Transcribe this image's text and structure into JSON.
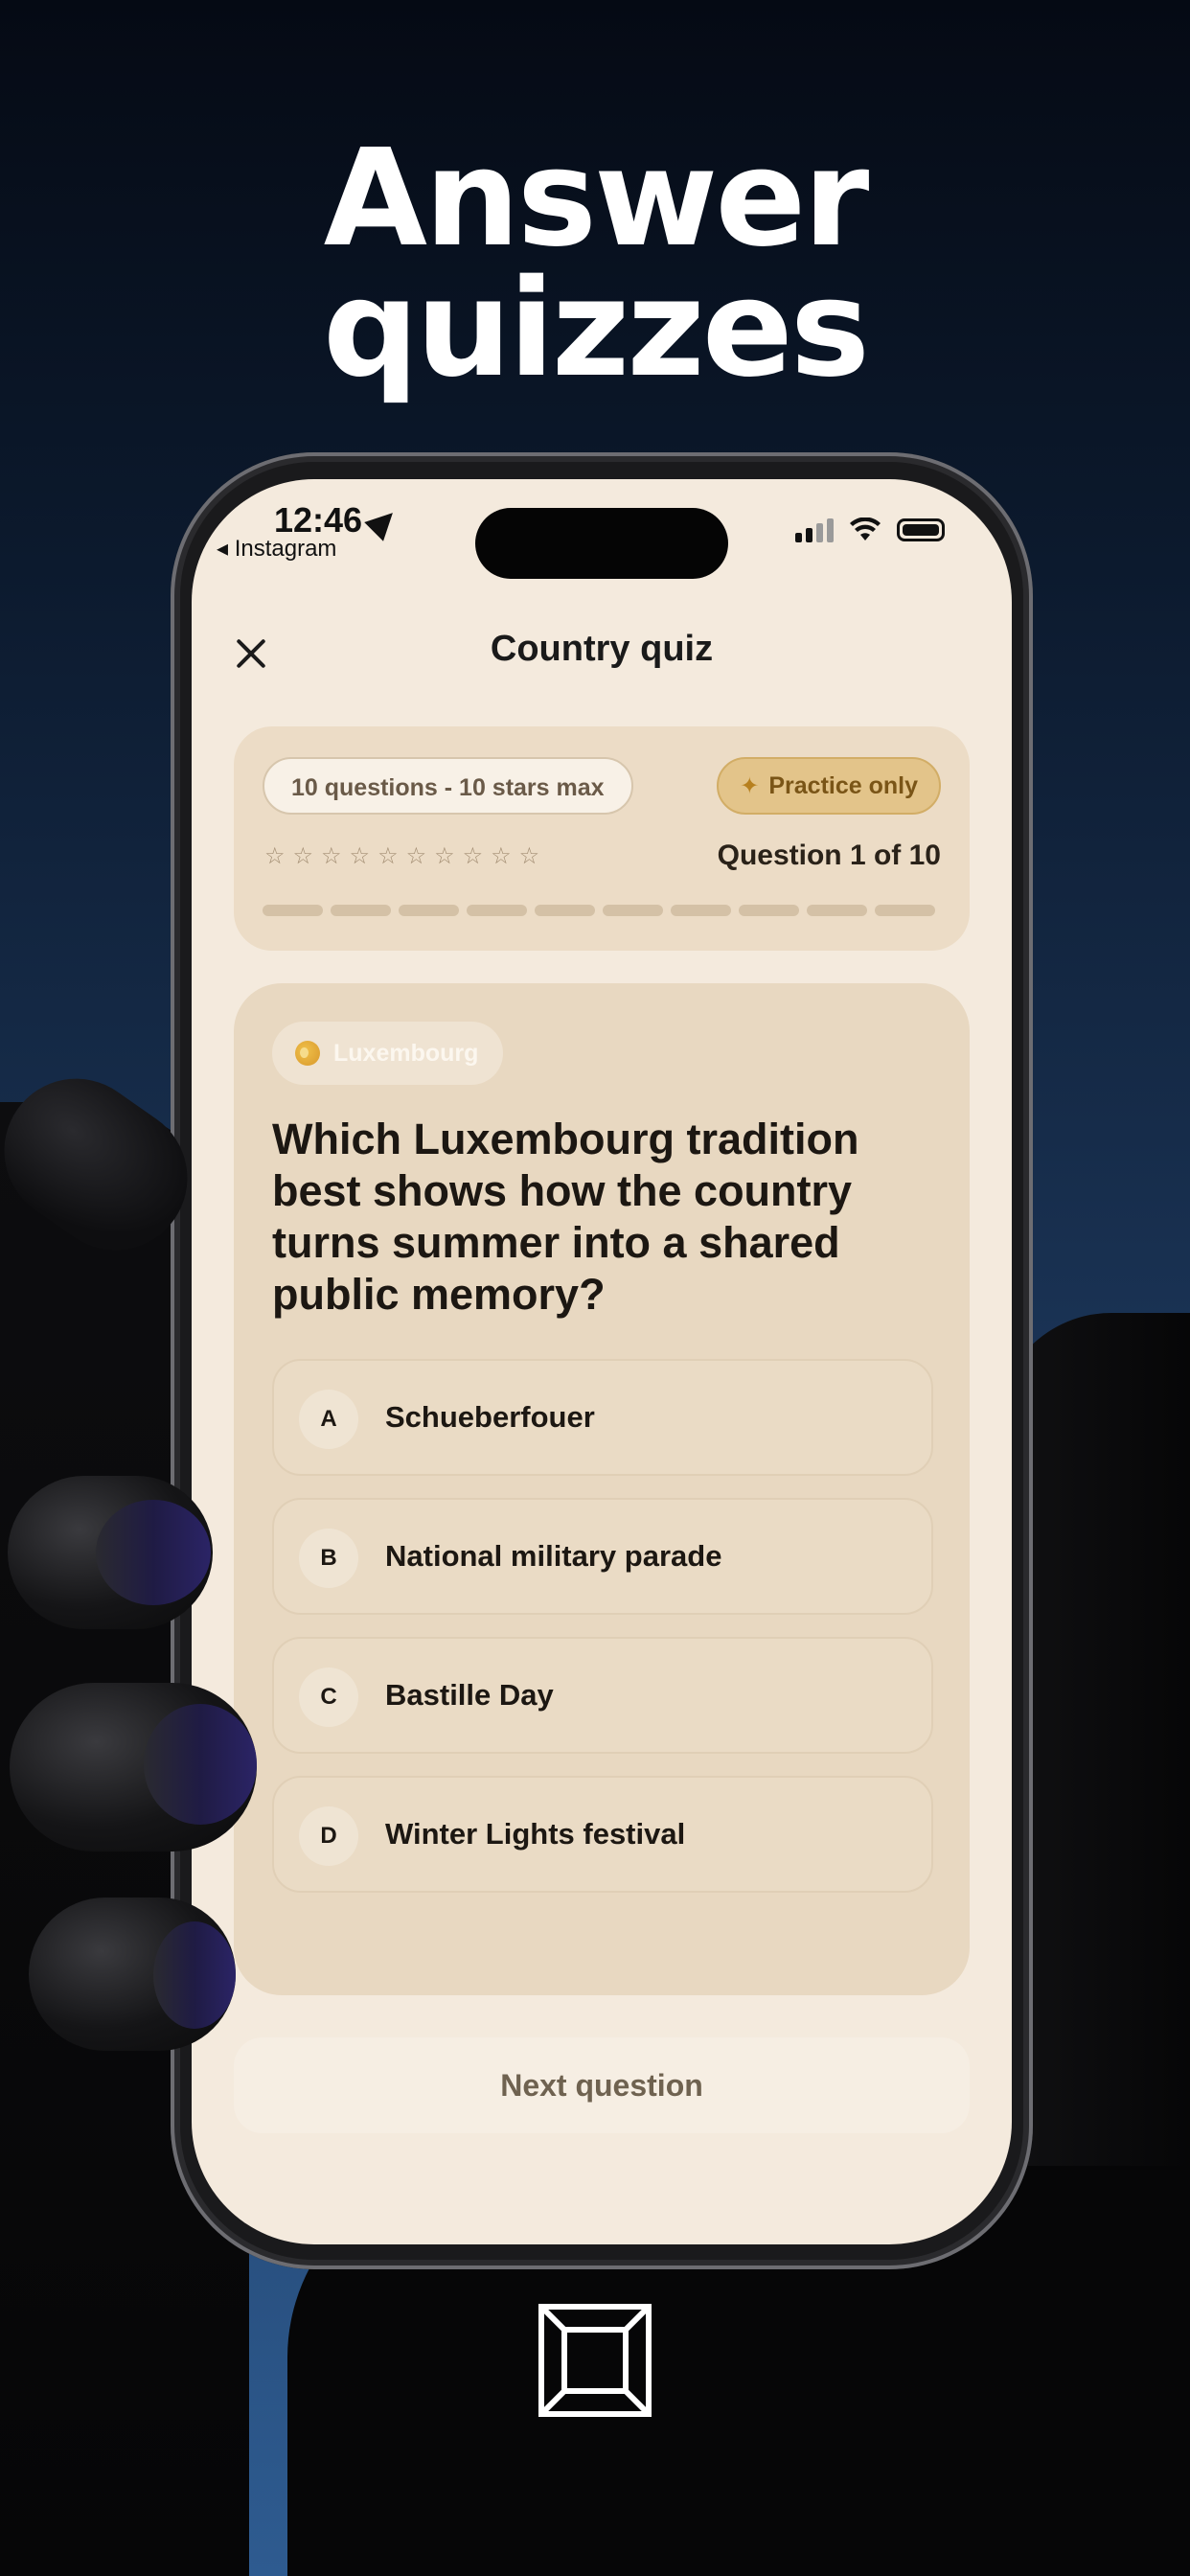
{
  "headline": {
    "line1": "Answer",
    "line2": "quizzes"
  },
  "status_bar": {
    "time": "12:46",
    "back_app": "◂ Instagram"
  },
  "header": {
    "title": "Country quiz"
  },
  "progress": {
    "questions_pill": "10 questions - 10 stars max",
    "practice_pill": "Practice only",
    "question_counter": "Question 1 of 10",
    "stars_total": 10,
    "stars_filled": 0,
    "segments_total": 10,
    "segments_done": 0
  },
  "quiz": {
    "country": "Luxembourg",
    "question": "Which Luxembourg tradition best shows how the country turns summer into a shared public memory?",
    "options": [
      {
        "letter": "A",
        "text": "Schueberfouer"
      },
      {
        "letter": "B",
        "text": "National military parade"
      },
      {
        "letter": "C",
        "text": "Bastille Day"
      },
      {
        "letter": "D",
        "text": "Winter Lights festival"
      }
    ]
  },
  "footer": {
    "next_label": "Next question"
  },
  "colors": {
    "screen_bg": "#f4eadd",
    "accent_gold": "#e3c48a",
    "card_bg": "#e8d8c1"
  },
  "icons": {
    "close": "close-icon",
    "location": "location-arrow-icon",
    "practice": "sparkle-icon",
    "country": "globe-icon",
    "brand": "brand-logo-icon"
  }
}
